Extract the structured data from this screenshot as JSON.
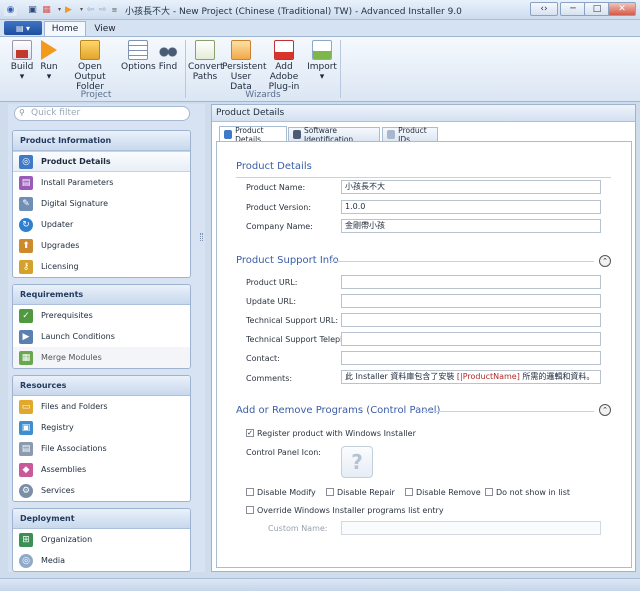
{
  "window": {
    "title": "小孩長不大 - New Project (Chinese (Traditional) TW) - Advanced Installer 9.0",
    "controls": [
      "‹›",
      "─",
      "□",
      "✕"
    ]
  },
  "ribbon": {
    "tabs": [
      "Home",
      "View"
    ],
    "groups": [
      {
        "label": "Project",
        "buttons": [
          "Build",
          "Run",
          "Open Output Folder",
          "Options",
          "Find"
        ]
      },
      {
        "label": "Wizards",
        "buttons": [
          "Convert Paths",
          "Persistent User Data",
          "Add Adobe Plug-in",
          "Import"
        ]
      }
    ],
    "build_label": "Build",
    "run_label": "Run",
    "open_output_label_1": "Open Output",
    "open_output_label_2": "Folder",
    "options_label": "Options",
    "find_label": "Find",
    "convert_label_1": "Convert",
    "convert_label_2": "Paths",
    "persistent_label_1": "Persistent",
    "persistent_label_2": "User Data",
    "adobe_label_1": "Add Adobe",
    "adobe_label_2": "Plug-in",
    "import_label": "Import",
    "project_group": "Project",
    "wizards_group": "Wizards",
    "dropdown_arrow": "▾"
  },
  "sidebar": {
    "filter_placeholder": "Quick filter",
    "sections": [
      {
        "title": "Product Information",
        "items": [
          "Product Details",
          "Install Parameters",
          "Digital Signature",
          "Updater",
          "Upgrades",
          "Licensing"
        ]
      },
      {
        "title": "Requirements",
        "items": [
          "Prerequisites",
          "Launch Conditions",
          "Merge Modules"
        ]
      },
      {
        "title": "Resources",
        "items": [
          "Files and Folders",
          "Registry",
          "File Associations",
          "Assemblies",
          "Services"
        ]
      },
      {
        "title": "Deployment",
        "items": [
          "Organization",
          "Media"
        ]
      }
    ]
  },
  "main": {
    "header": "Product Details",
    "tabs": [
      "Product Details",
      "Software Identification",
      "Product IDs"
    ],
    "product_details": {
      "title": "Product Details",
      "name_label": "Product Name:",
      "name_value": "小孩長不大",
      "version_label": "Product Version:",
      "version_value": "1.0.0",
      "company_label": "Company Name:",
      "company_value": "金剛帶小孩"
    },
    "support_info": {
      "title": "Product Support Info",
      "url_label": "Product URL:",
      "update_label": "Update URL:",
      "tech_url_label": "Technical Support URL:",
      "tech_phone_label": "Technical Support Telephone:",
      "contact_label": "Contact:",
      "comments_label": "Comments:",
      "comments_prefix": "此 Installer 資料庫包含了安裝 ",
      "comments_token": "[|ProductName]",
      "comments_suffix": " 所需的邏輯和資料。"
    },
    "add_remove": {
      "title": "Add or Remove Programs (Control Panel)",
      "register_label": "Register product with Windows Installer",
      "register_checked": true,
      "icon_label": "Control Panel Icon:",
      "disable_modify": "Disable Modify",
      "disable_repair": "Disable Repair",
      "disable_remove": "Disable Remove",
      "do_not_show": "Do not show in list",
      "override_label": "Override Windows Installer programs list entry",
      "custom_name_label": "Custom Name:"
    },
    "collapse_glyph": "⌃"
  }
}
